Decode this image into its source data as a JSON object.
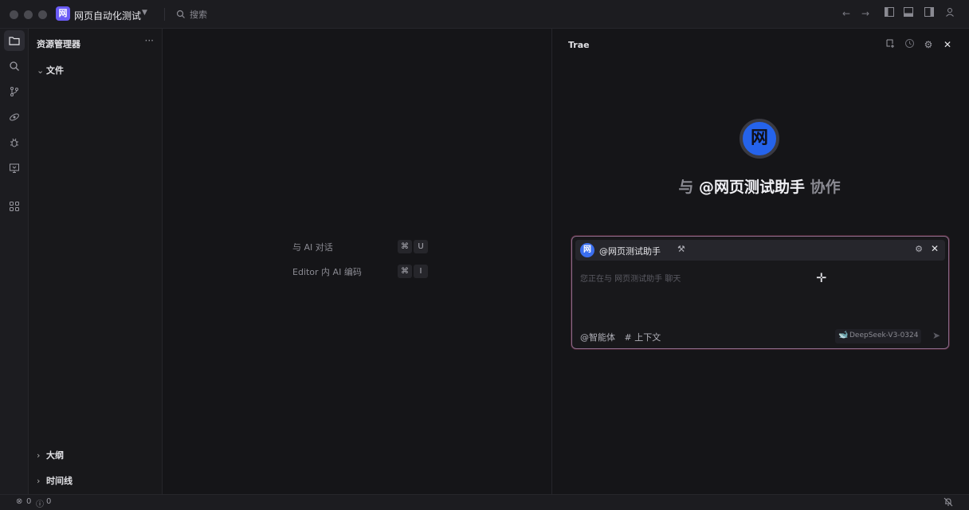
{
  "titlebar": {
    "app_logo": "网",
    "app_title": "网页自动化测试",
    "search_placeholder": "搜索"
  },
  "explorer": {
    "title": "资源管理器",
    "more": "···",
    "sections": [
      {
        "label": "文件",
        "expanded": true
      },
      {
        "label": "大纲",
        "expanded": false
      },
      {
        "label": "时间线",
        "expanded": false
      }
    ]
  },
  "editor": {
    "hints": [
      {
        "label": "与 AI 对话",
        "keys": [
          "⌘",
          "U"
        ]
      },
      {
        "label": "Editor 内 AI 编码",
        "keys": [
          "⌘",
          "I"
        ]
      }
    ]
  },
  "chat": {
    "title": "Trae",
    "agent_avatar": "网",
    "collab_prefix": "与",
    "collab_agent": "@网页测试助手",
    "collab_suffix": "协作",
    "input": {
      "agent_name": "@网页测试助手",
      "placeholder": "您正在与 网页测试助手 聊天",
      "agent_button": "@智能体",
      "context_button": "# 上下文",
      "model": "DeepSeek-V3-0324"
    }
  },
  "statusbar": {
    "errors": "0",
    "warnings": "0"
  },
  "colors": {
    "accent": "#6b5cf6",
    "agent_blue": "#2563eb",
    "background": "#151518"
  }
}
